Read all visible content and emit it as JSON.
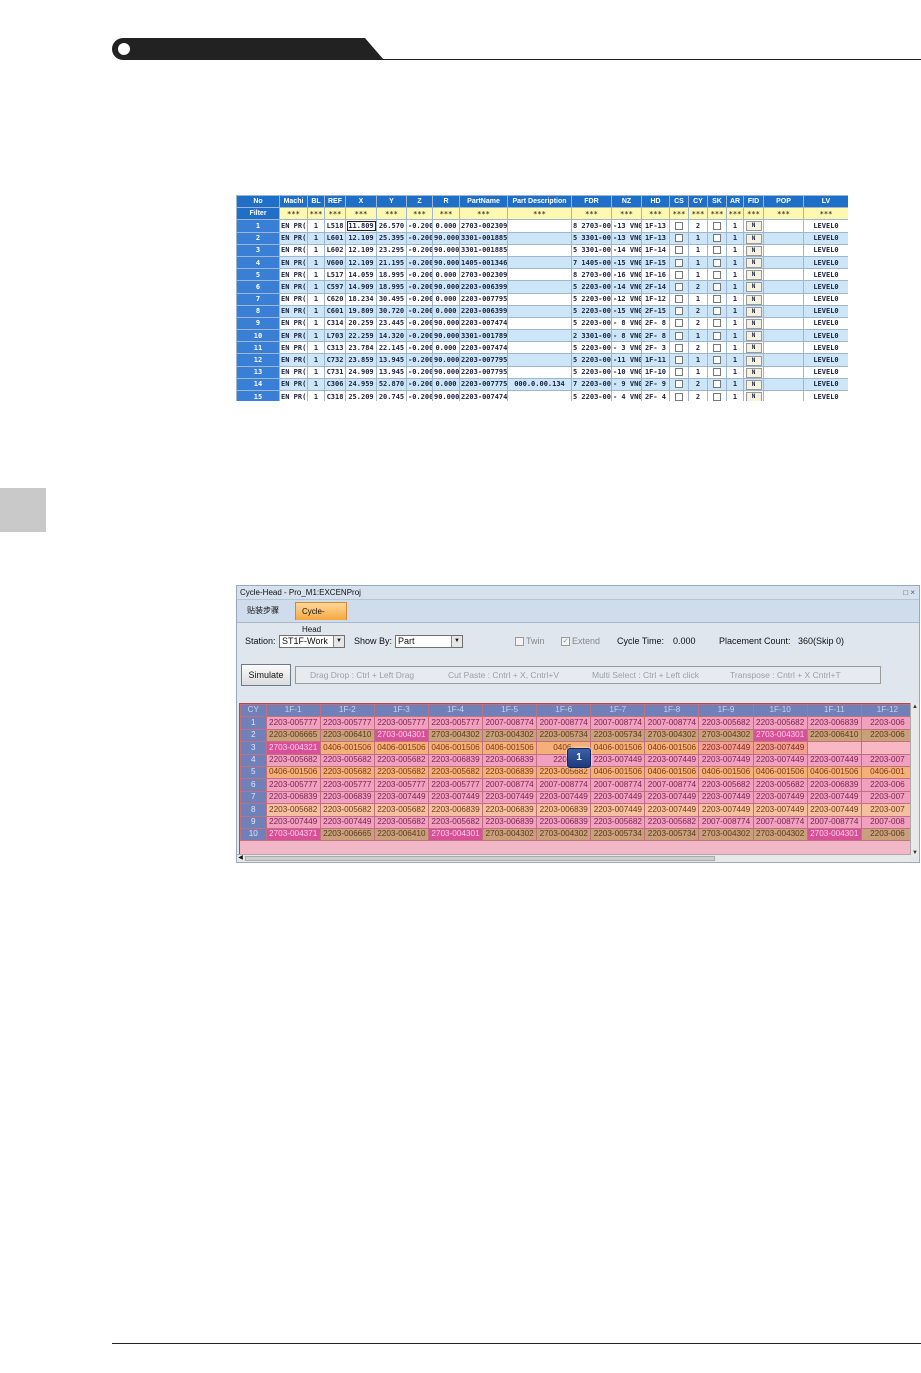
{
  "parts_table": {
    "header": [
      "No",
      "Machi",
      "BL",
      "REF",
      "X",
      "Y",
      "Z",
      "R",
      "PartName",
      "Part Description",
      "FDR",
      "NZ",
      "HD",
      "CS",
      "CY",
      "SK",
      "AR",
      "FID",
      "POP",
      "LV"
    ],
    "filter_label": "Filter",
    "filter_values": [
      "***",
      "***",
      "***",
      "***",
      "***",
      "***",
      "***",
      "***",
      "***",
      "***",
      "***",
      "***",
      "***",
      "***",
      "***",
      "***",
      "***",
      "***",
      "***"
    ],
    "rows": [
      [
        "1",
        "EN PR(",
        "1",
        "L518",
        "11.809",
        "26.570",
        "-0.200",
        "0.000",
        "2703-002309",
        "",
        "8 2703-002",
        "-13 VN0:",
        "1F-13",
        "",
        "2",
        "",
        "1",
        "N",
        "",
        "LEVEL0"
      ],
      [
        "2",
        "EN PR(",
        "1",
        "L601",
        "12.109",
        "25.395",
        "-0.200",
        "90.000",
        "3301-001885-1",
        "",
        "5 3301-0018",
        "-13 VN0:",
        "1F-13",
        "",
        "1",
        "",
        "1",
        "N",
        "",
        "LEVEL0"
      ],
      [
        "3",
        "EN PR(",
        "1",
        "L602",
        "12.109",
        "23.295",
        "-0.200",
        "90.000",
        "3301-001885-1",
        "",
        "5 3301-0018",
        "-14 VN0:",
        "1F-14",
        "",
        "1",
        "",
        "1",
        "N",
        "",
        "LEVEL0"
      ],
      [
        "4",
        "EN PR(",
        "1",
        "V600",
        "12.109",
        "21.195",
        "-0.200",
        "90.000",
        "1405-001346",
        "",
        "7 1405-001",
        "-15 VN0:",
        "1F-15",
        "",
        "1",
        "",
        "1",
        "N",
        "",
        "LEVEL0"
      ],
      [
        "5",
        "EN PR(",
        "1",
        "L517",
        "14.059",
        "18.995",
        "-0.200",
        "0.000",
        "2703-002309",
        "",
        "8 2703-002",
        "-16 VN0:",
        "1F-16",
        "",
        "1",
        "",
        "1",
        "N",
        "",
        "LEVEL0"
      ],
      [
        "6",
        "EN PR(",
        "1",
        "C597",
        "14.909",
        "18.995",
        "-0.200",
        "90.000",
        "2203-006399",
        "",
        "5 2203-006",
        "-14 VN0:",
        "2F-14",
        "",
        "2",
        "",
        "1",
        "N",
        "",
        "LEVEL0"
      ],
      [
        "7",
        "EN PR(",
        "1",
        "C620",
        "18.234",
        "30.495",
        "-0.200",
        "0.000",
        "2203-007795",
        "",
        "5 2203-007",
        "-12 VN0:",
        "1F-12",
        "",
        "1",
        "",
        "1",
        "N",
        "",
        "LEVEL0"
      ],
      [
        "8",
        "EN PR(",
        "1",
        "C601",
        "19.809",
        "30.720",
        "-0.200",
        "0.000",
        "2203-006399",
        "",
        "5 2203-006",
        "-15 VN0:",
        "2F-15",
        "",
        "2",
        "",
        "1",
        "N",
        "",
        "LEVEL0"
      ],
      [
        "9",
        "EN PR(",
        "1",
        "C314",
        "20.259",
        "23.445",
        "-0.200",
        "90.000",
        "2203-007474-1",
        "",
        "5 2203-007",
        "- 8 VN0:",
        "2F- 8",
        "",
        "2",
        "",
        "1",
        "N",
        "",
        "LEVEL0"
      ],
      [
        "10",
        "EN PR(",
        "1",
        "L703",
        "22.259",
        "14.320",
        "-0.200",
        "90.000",
        "3301-001789",
        "",
        "2 3301-001",
        "- 8 VN0:",
        "2F- 8",
        "",
        "1",
        "",
        "1",
        "N",
        "",
        "LEVEL0"
      ],
      [
        "11",
        "EN PR(",
        "1",
        "C313",
        "23.784",
        "22.145",
        "-0.200",
        "0.000",
        "2203-007474",
        "",
        "5 2203-007",
        "- 3 VN0:",
        "2F- 3",
        "",
        "2",
        "",
        "1",
        "N",
        "",
        "LEVEL0"
      ],
      [
        "12",
        "EN PR(",
        "1",
        "C732",
        "23.859",
        "13.945",
        "-0.200",
        "90.000",
        "2203-007795",
        "",
        "5 2203-007",
        "-11 VN0:",
        "1F-11",
        "",
        "1",
        "",
        "1",
        "N",
        "",
        "LEVEL0"
      ],
      [
        "13",
        "EN PR(",
        "1",
        "C731",
        "24.909",
        "13.945",
        "-0.200",
        "90.000",
        "2203-007795",
        "",
        "5 2203-007",
        "-10 VN0:",
        "1F-10",
        "",
        "1",
        "",
        "1",
        "N",
        "",
        "LEVEL0"
      ],
      [
        "14",
        "EN PR(",
        "1",
        "C306",
        "24.959",
        "52.870",
        "-0.200",
        "0.000",
        "2203-007775",
        "000.0.00.134",
        "7 2203-007",
        "- 9 VN0:",
        "2F- 9",
        "",
        "2",
        "",
        "1",
        "N",
        "",
        "LEVEL0"
      ],
      [
        "15",
        "EN PR(",
        "1",
        "C318",
        "25.209",
        "20.745",
        "-0.200",
        "90.000",
        "2203-007474",
        "",
        "5 2203-007",
        "- 4 VN0:",
        "2F- 4",
        "",
        "2",
        "",
        "1",
        "N",
        "",
        "LEVEL0"
      ],
      [
        "16",
        "EN PR(",
        "1",
        "C730",
        "25.959",
        "13.945",
        "-0.200",
        "90.000",
        "2203-007795",
        "",
        "5 2203-007",
        "- 9 VN0:",
        "1F- 9",
        "",
        "1",
        "",
        "1",
        "N",
        "",
        "LEVEL0"
      ]
    ]
  },
  "window": {
    "title": "Cycle-Head - Pro_M1:EXCENProj",
    "controls": "□ ×",
    "tab_plain": "贴装步骤",
    "tab_active": "Cycle-Head",
    "station_label": "Station:",
    "station_value": "ST1F-Work",
    "showby_label": "Show By:",
    "showby_value": "Part",
    "twin_label": "Twin",
    "extend_label": "Extend",
    "cycle_time_label": "Cycle Time:",
    "cycle_time_value": "0.000",
    "placement_label": "Placement Count:",
    "placement_value": "360(Skip 0)",
    "simulate_label": "Simulate",
    "hints": [
      "Drag Drop : Ctrl + Left Drag",
      "Cut Paste : Cntrl + X, Cntrl+V",
      "Multi Select : Ctrl + Left click",
      "Transpose : Cntrl + X Cntrl+T"
    ],
    "badge": "1"
  },
  "cycle_grid": {
    "corner": "CY",
    "columns": [
      "1F-1",
      "1F-2",
      "1F-3",
      "1F-4",
      "1F-5",
      "1F-6",
      "1F-7",
      "1F-8",
      "1F-9",
      "1F-10",
      "1F-11",
      "1F-12"
    ],
    "rows": [
      {
        "cy": "1",
        "cells": [
          "2203-005777",
          "2203-005777",
          "2203-005777",
          "2203-005777",
          "2007-008774",
          "2007-008774",
          "2007-008774",
          "2007-008774",
          "2203-005682",
          "2203-005682",
          "2203-006839",
          "2203-006"
        ],
        "colors": [
          "pink",
          "pink",
          "pink",
          "pink",
          "pink",
          "pink",
          "pink",
          "pink",
          "pink",
          "pink",
          "pink",
          "pink"
        ]
      },
      {
        "cy": "2",
        "cells": [
          "2203-006665",
          "2203-006410",
          "2703-004301",
          "2703-004302",
          "2703-004302",
          "2203-005734",
          "2203-005734",
          "2703-004302",
          "2703-004302",
          "2703-004301",
          "2203-006410",
          "2203-006"
        ],
        "colors": [
          "olive",
          "olive",
          "magenta",
          "olive",
          "olive",
          "olive",
          "olive",
          "olive",
          "olive",
          "magenta",
          "olive",
          "olive"
        ]
      },
      {
        "cy": "3",
        "cells": [
          "2703-004321",
          "0406-001506",
          "0406-001506",
          "0406-001506",
          "0406-001506",
          "0406-",
          "0406-001506",
          "0406-001506",
          "2203-007449",
          "2203-007449",
          "",
          ""
        ],
        "colors": [
          "magenta",
          "orange",
          "orange",
          "orange",
          "orange",
          "orange",
          "orange",
          "orange",
          "salmon",
          "salmon",
          "empty",
          "empty"
        ]
      },
      {
        "cy": "4",
        "cells": [
          "2203-005682",
          "2203-005682",
          "2203-005682",
          "2203-006839",
          "2203-006839",
          "2203-",
          "2203-007449",
          "2203-007449",
          "2203-007449",
          "2203-007449",
          "2203-007449",
          "2203-007"
        ],
        "colors": [
          "pink",
          "pink",
          "pink",
          "pink",
          "pink",
          "pink",
          "pink",
          "pink",
          "pink",
          "pink",
          "pink",
          "pink"
        ]
      },
      {
        "cy": "5",
        "cells": [
          "0406-001506",
          "2203-005682",
          "2203-005682",
          "2203-005682",
          "2203-006839",
          "2203-005682",
          "0406-001506",
          "0406-001506",
          "0406-001506",
          "0406-001506",
          "0406-001506",
          "0406-001"
        ],
        "colors": [
          "orange",
          "orange",
          "orange",
          "orange",
          "orange",
          "orange",
          "orange",
          "orange",
          "orange",
          "orange",
          "orange",
          "orange"
        ]
      },
      {
        "cy": "6",
        "cells": [
          "2203-005777",
          "2203-005777",
          "2203-005777",
          "2203-005777",
          "2007-008774",
          "2007-008774",
          "2007-008774",
          "2007-008774",
          "2203-005682",
          "2203-005682",
          "2203-006839",
          "2203-006"
        ],
        "colors": [
          "pink",
          "pink",
          "pink",
          "pink",
          "pink",
          "pink",
          "pink",
          "pink",
          "pink",
          "pink",
          "pink",
          "pink"
        ]
      },
      {
        "cy": "7",
        "cells": [
          "2203-006839",
          "2203-006839",
          "2203-007449",
          "2203-007449",
          "2203-007449",
          "2203-007449",
          "2203-007449",
          "2203-007449",
          "2203-007449",
          "2203-007449",
          "2203-007449",
          "2203-007"
        ],
        "colors": [
          "pink",
          "pink",
          "pink",
          "pink",
          "pink",
          "pink",
          "pink",
          "pink",
          "pink",
          "pink",
          "pink",
          "pink"
        ]
      },
      {
        "cy": "8",
        "cells": [
          "2203-005682",
          "2203-005682",
          "2203-005682",
          "2203-006839",
          "2203-006839",
          "2203-006839",
          "2203-007449",
          "2203-007449",
          "2203-007449",
          "2203-007449",
          "2203-007449",
          "2203-007"
        ],
        "colors": [
          "peach",
          "peach",
          "peach",
          "peach",
          "peach",
          "peach",
          "peach",
          "peach",
          "peach",
          "peach",
          "peach",
          "peach"
        ]
      },
      {
        "cy": "9",
        "cells": [
          "2203-007449",
          "2203-007449",
          "2203-005682",
          "2203-005682",
          "2203-006839",
          "2203-006839",
          "2203-005682",
          "2203-005682",
          "2007-008774",
          "2007-008774",
          "2007-008774",
          "2007-008"
        ],
        "colors": [
          "pink",
          "pink",
          "pink",
          "pink",
          "pink",
          "pink",
          "pink",
          "pink",
          "pink",
          "pink",
          "pink",
          "pink"
        ]
      },
      {
        "cy": "10",
        "cells": [
          "2703-004371",
          "2203-006665",
          "2203-006410",
          "2703-004301",
          "2703-004302",
          "2703-004302",
          "2203-005734",
          "2203-005734",
          "2703-004302",
          "2703-004302",
          "2703-004301",
          "2203-006"
        ],
        "colors": [
          "magenta",
          "olive",
          "olive",
          "magenta",
          "olive",
          "olive",
          "olive",
          "olive",
          "olive",
          "olive",
          "magenta",
          "olive"
        ]
      }
    ]
  }
}
